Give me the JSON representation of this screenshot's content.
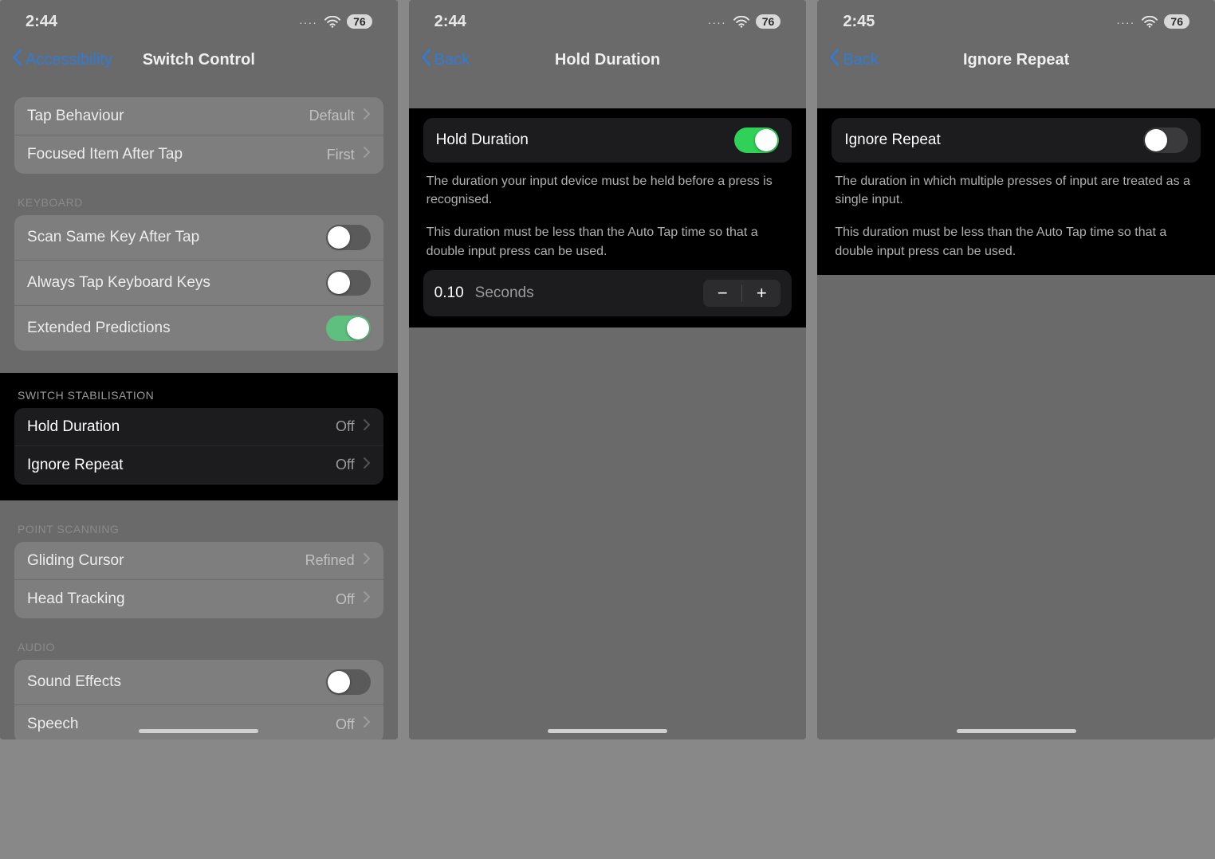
{
  "phone1": {
    "status": {
      "time": "2:44",
      "signal_dots": "....",
      "battery": "76"
    },
    "nav": {
      "back": "Accessibility",
      "title": "Switch Control"
    },
    "group1": {
      "rows": [
        {
          "label": "Tap Behaviour",
          "value": "Default"
        },
        {
          "label": "Focused Item After Tap",
          "value": "First"
        }
      ]
    },
    "group2": {
      "header": "KEYBOARD",
      "rows": [
        {
          "label": "Scan Same Key After Tap",
          "toggle": "off"
        },
        {
          "label": "Always Tap Keyboard Keys",
          "toggle": "off"
        },
        {
          "label": "Extended Predictions",
          "toggle": "on"
        }
      ]
    },
    "group3": {
      "header": "SWITCH STABILISATION",
      "rows": [
        {
          "label": "Hold Duration",
          "value": "Off"
        },
        {
          "label": "Ignore Repeat",
          "value": "Off"
        }
      ]
    },
    "group4": {
      "header": "POINT SCANNING",
      "rows": [
        {
          "label": "Gliding Cursor",
          "value": "Refined"
        },
        {
          "label": "Head Tracking",
          "value": "Off"
        }
      ]
    },
    "group5": {
      "header": "AUDIO",
      "rows": [
        {
          "label": "Sound Effects",
          "toggle": "off"
        },
        {
          "label": "Speech",
          "value": "Off"
        }
      ]
    }
  },
  "phone2": {
    "status": {
      "time": "2:44",
      "signal_dots": "....",
      "battery": "76"
    },
    "nav": {
      "back": "Back",
      "title": "Hold Duration"
    },
    "row_label": "Hold Duration",
    "row_toggle": "on",
    "footer1": "The duration your input device must be held before a press is recognised.",
    "footer2": "This duration must be less than the Auto Tap time so that a double input press can be used.",
    "stepper": {
      "value": "0.10",
      "unit": "Seconds"
    }
  },
  "phone3": {
    "status": {
      "time": "2:45",
      "signal_dots": "....",
      "battery": "76"
    },
    "nav": {
      "back": "Back",
      "title": "Ignore Repeat"
    },
    "row_label": "Ignore Repeat",
    "row_toggle": "off",
    "footer1": "The duration in which multiple presses of input are treated as a single input.",
    "footer2": "This duration must be less than the Auto Tap time so that a double input press can be used."
  }
}
